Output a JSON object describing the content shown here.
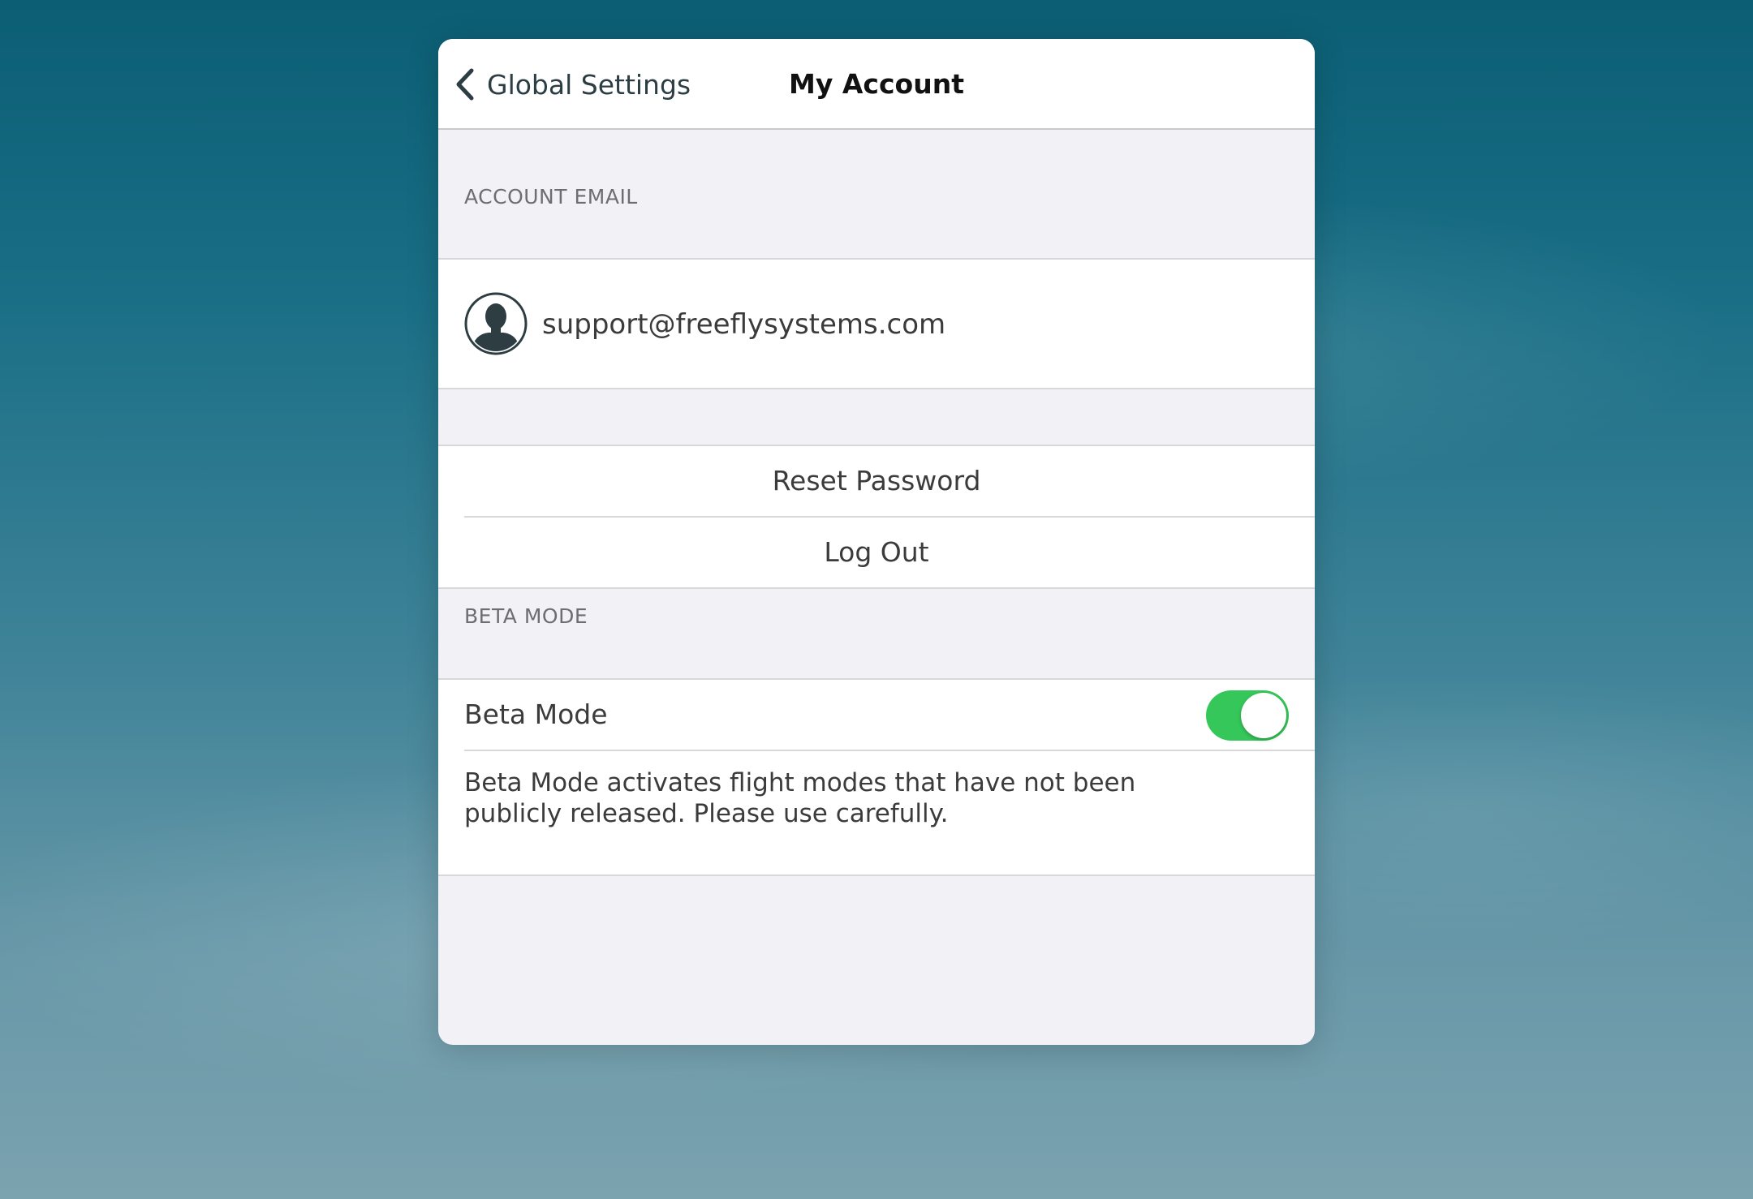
{
  "navbar": {
    "back_label": "Global Settings",
    "title": "My Account"
  },
  "account_email": {
    "header": "ACCOUNT EMAIL",
    "email": "support@freeflysystems.com",
    "avatar_icon": "user-silhouette-icon"
  },
  "actions": {
    "reset_password": "Reset Password",
    "log_out": "Log Out"
  },
  "beta_mode": {
    "header": "BETA MODE",
    "label": "Beta Mode",
    "enabled": true,
    "description": "Beta Mode activates flight modes that have not been publicly released. Please use carefully."
  },
  "colors": {
    "toggle_on": "#35c759",
    "group_background": "#f1f1f6",
    "row_background": "#ffffff"
  }
}
